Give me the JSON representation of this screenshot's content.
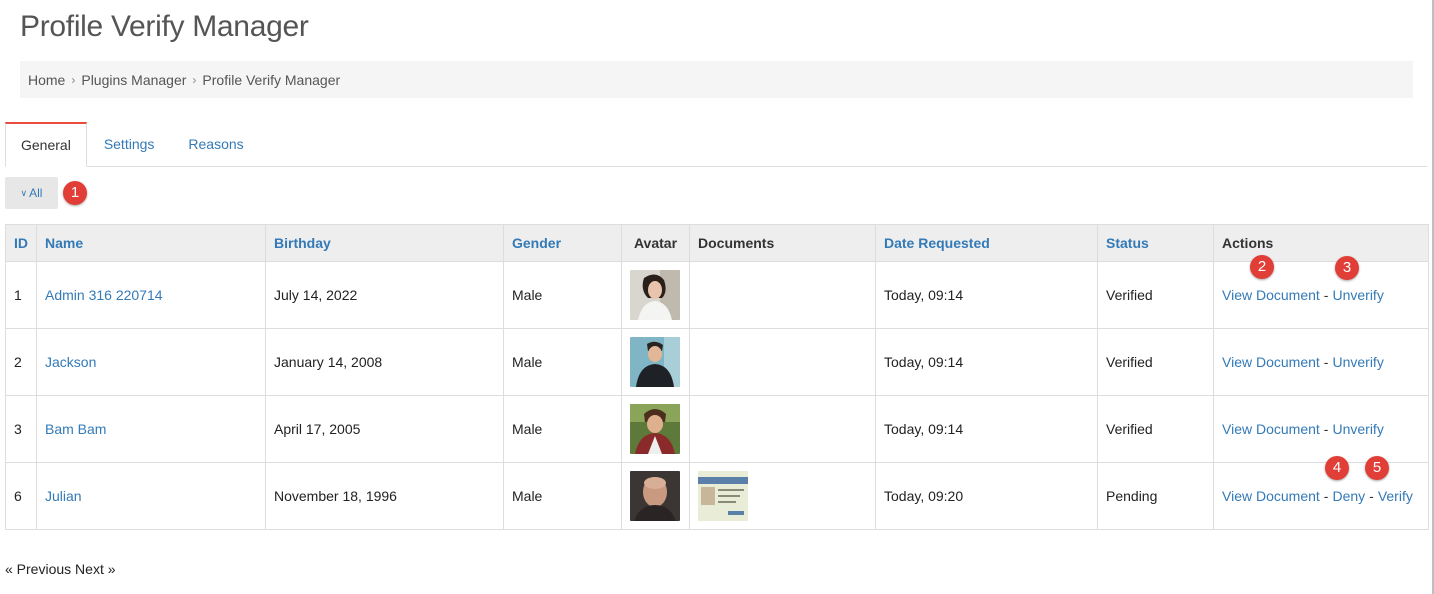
{
  "page": {
    "title": "Profile Verify Manager"
  },
  "breadcrumb": [
    "Home",
    "Plugins Manager",
    "Profile Verify Manager"
  ],
  "tabs": [
    {
      "label": "General",
      "active": true
    },
    {
      "label": "Settings",
      "active": false
    },
    {
      "label": "Reasons",
      "active": false
    }
  ],
  "filter": {
    "label": "All"
  },
  "markers": [
    "1",
    "2",
    "3",
    "4",
    "5"
  ],
  "table": {
    "headers": {
      "id": "ID",
      "name": "Name",
      "birthday": "Birthday",
      "gender": "Gender",
      "avatar": "Avatar",
      "documents": "Documents",
      "date_requested": "Date Requested",
      "status": "Status",
      "actions": "Actions"
    },
    "rows": [
      {
        "id": "1",
        "name": "Admin 316 220714",
        "birthday": "July 14, 2022",
        "gender": "Male",
        "date_requested": "Today, 09:14",
        "status": "Verified",
        "actions": [
          "View Document",
          "Unverify"
        ]
      },
      {
        "id": "2",
        "name": "Jackson",
        "birthday": "January 14, 2008",
        "gender": "Male",
        "date_requested": "Today, 09:14",
        "status": "Verified",
        "actions": [
          "View Document",
          "Unverify"
        ]
      },
      {
        "id": "3",
        "name": "Bam Bam",
        "birthday": "April 17, 2005",
        "gender": "Male",
        "date_requested": "Today, 09:14",
        "status": "Verified",
        "actions": [
          "View Document",
          "Unverify"
        ]
      },
      {
        "id": "6",
        "name": "Julian",
        "birthday": "November 18, 1996",
        "gender": "Male",
        "date_requested": "Today, 09:20",
        "status": "Pending",
        "actions": [
          "View Document",
          "Deny",
          "Verify"
        ]
      }
    ]
  },
  "pagination": {
    "previous": "« Previous",
    "next": "Next »"
  },
  "colors": {
    "link": "#337ab7",
    "accent": "#e74c3c",
    "marker": "#e03e36"
  }
}
